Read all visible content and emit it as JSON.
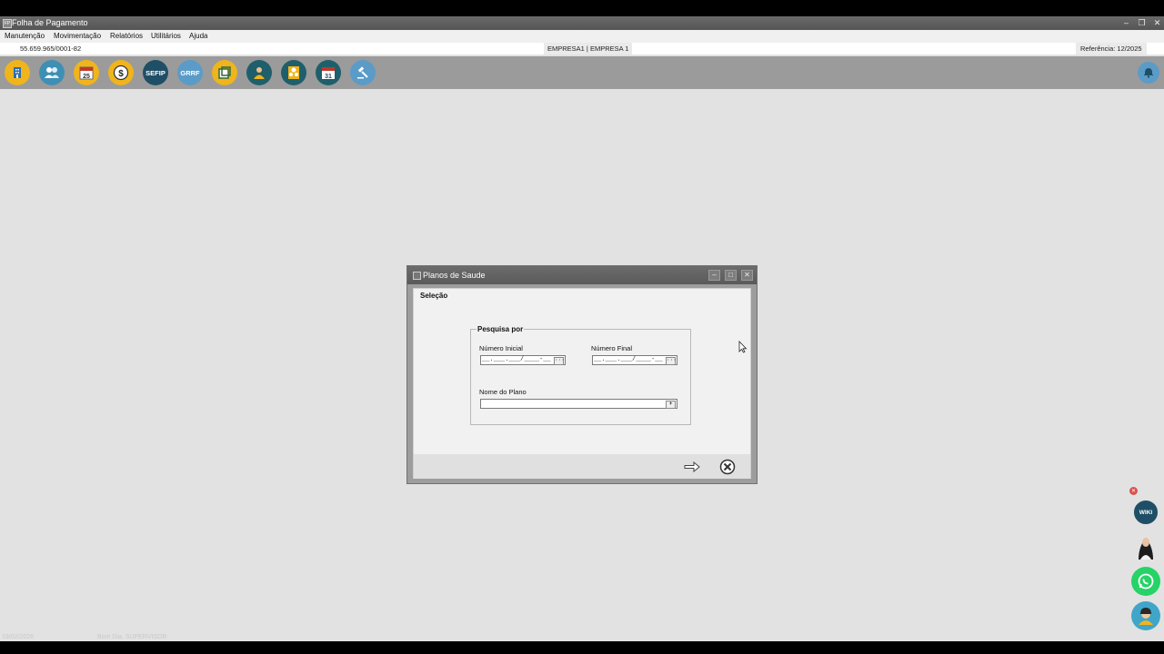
{
  "window": {
    "title": "Folha de Pagamento",
    "controls": [
      "–",
      "❐",
      "✕"
    ]
  },
  "menu": [
    "Manutenção",
    "Movimentação",
    "Relatórios",
    "Utilitários",
    "Ajuda"
  ],
  "info": {
    "cnpj": "55.659.965/0001-82",
    "empresa": "EMPRESA1 | EMPRESA 1",
    "referencia": "Referência: 12/2025"
  },
  "toolbar": {
    "sefip_label": "SEFIP",
    "grrf_label": "GRRF",
    "calendar_day_a": "25",
    "calendar_day_b": "31",
    "dollar_label": "$",
    "colors": {
      "bg": "#9b9b9b",
      "gold": "#f0b41c",
      "teal": "#1f5f6b",
      "blue": "#3f8fb5"
    }
  },
  "dialog": {
    "title": "Planos de Saude",
    "selection_legend": "Seleção",
    "group_legend": "Pesquisa por",
    "numero_inicial_label": "Número Inicial",
    "numero_final_label": "Número Final",
    "nome_plano_label": "Nome do Plano",
    "numero_inicial_value": "__.___.___/____-__",
    "numero_final_value": "__.___.___/____-__",
    "nome_plano_value": "",
    "lookup_button": "···",
    "dropdown_button": "+"
  },
  "bottom": {
    "date": "19/02/2026",
    "user": "Bom Dia, SUPERVISOR"
  }
}
